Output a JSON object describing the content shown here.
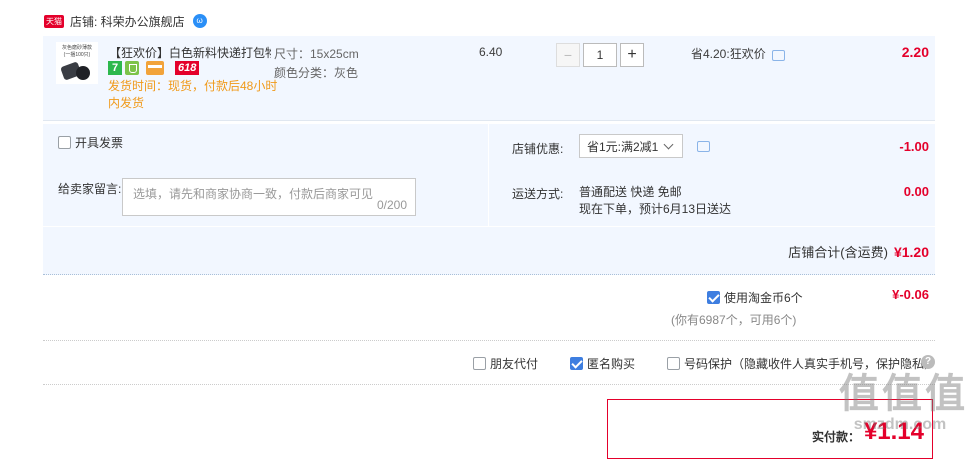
{
  "shop": {
    "badge": "天猫",
    "label": "店铺: 科荣办公旗舰店"
  },
  "item": {
    "thumb_text_1": "灰色磨砂薄款",
    "thumb_text_2": "(一捆100只)",
    "title": "【狂欢价】白色新料快递打包物...",
    "badge_618": "618",
    "badge_7": "7",
    "shipping_note_1": "发货时间：现货，付款后48小时",
    "shipping_note_2": "内发货",
    "spec_size": "尺寸：15x25cm",
    "spec_color": "颜色分类：灰色",
    "unit_price": "6.40",
    "qty_minus": "−",
    "qty_value": "1",
    "qty_plus": "+",
    "discount_text": "省4.20:狂欢价",
    "subtotal": "2.20"
  },
  "invoice": {
    "label": "开具发票"
  },
  "message": {
    "label": "给卖家留言:",
    "placeholder": "选填，请先和商家协商一致，付款后商家可见",
    "counter": "0/200"
  },
  "shop_discount": {
    "label": "店铺优惠:",
    "value": "省1元:满2减1",
    "amount": "-1.00"
  },
  "delivery": {
    "label": "运送方式:",
    "line1": "普通配送 快递 免邮",
    "line2": "现在下单，预计6月13日送达",
    "amount": "0.00"
  },
  "shop_total": {
    "label": "店铺合计(含运费)",
    "amount": "¥1.20"
  },
  "coins": {
    "label": "使用淘金币6个",
    "sub": "(你有6987个，可用6个)",
    "amount": "¥-0.06"
  },
  "options": {
    "friend_pay": "朋友代付",
    "anonymous": "匿名购买",
    "number_protect": "号码保护（隐藏收件人真实手机号，保护隐私）",
    "help": "?"
  },
  "pay": {
    "label": "实付款：",
    "amount": "¥1.14"
  },
  "watermark": "值 值 值",
  "watermark_site": "smzdm.com",
  "colors": {
    "accent_red": "#e4002b",
    "panel_blue": "#f2f7ff",
    "checkbox_blue": "#3e7ee0",
    "orange": "#f09a1a"
  }
}
